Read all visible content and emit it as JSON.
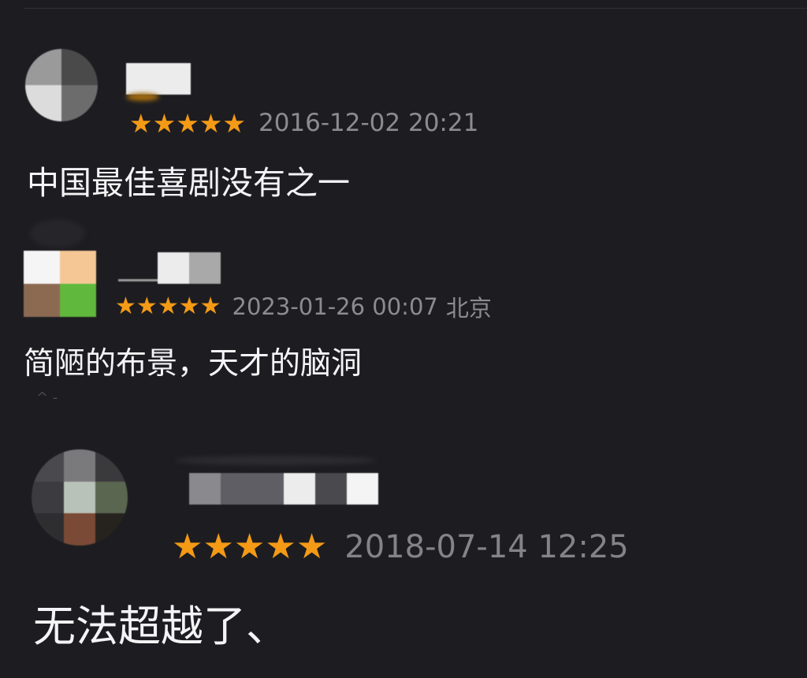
{
  "reviews": [
    {
      "rating": 5,
      "rating_max": 5,
      "timestamp": "2016-12-02 20:21",
      "location": "",
      "comment": "中国最佳喜剧没有之一"
    },
    {
      "rating": 5,
      "rating_max": 5,
      "timestamp": "2023-01-26 00:07",
      "location": "北京",
      "comment": "简陋的布景，天才的脑洞"
    },
    {
      "rating": 5,
      "rating_max": 5,
      "timestamp": "2018-07-14 12:25",
      "location": "",
      "comment": "无法超越了、"
    }
  ],
  "icons": {
    "star": "star-icon"
  },
  "colors": {
    "background": "#1d1d21",
    "star": "#f49a16",
    "meta_text": "#8b8b90",
    "comment_text": "#f4f4f6"
  }
}
